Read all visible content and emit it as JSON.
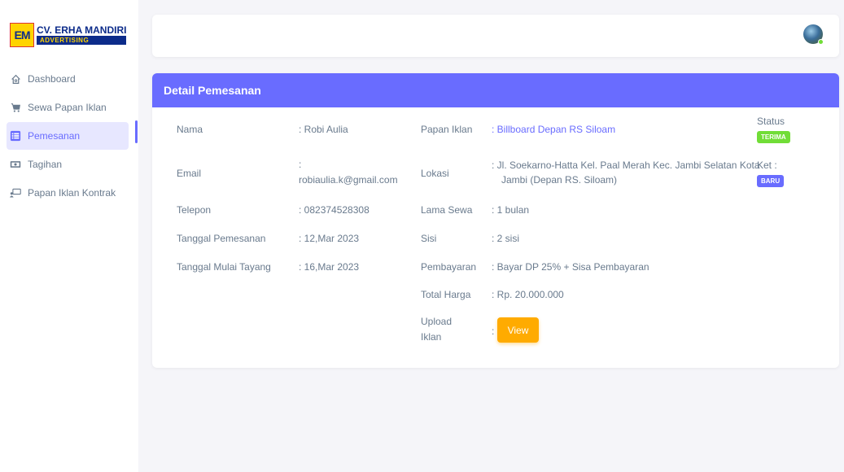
{
  "brand": {
    "mark": "EM",
    "name": "CV. ERHA MANDIRI",
    "sub": "ADVERTISING"
  },
  "sidebar": {
    "items": [
      {
        "label": "Dashboard",
        "icon": "home-icon"
      },
      {
        "label": "Sewa Papan Iklan",
        "icon": "cart-icon"
      },
      {
        "label": "Pemesanan",
        "icon": "list-icon",
        "active": true
      },
      {
        "label": "Tagihan",
        "icon": "money-icon"
      },
      {
        "label": "Papan Iklan Kontrak",
        "icon": "billboard-icon"
      }
    ]
  },
  "card": {
    "title": "Detail Pemesanan",
    "left": [
      {
        "label": "Nama",
        "value": ": Robi Aulia"
      },
      {
        "label": "Email",
        "value_prefix": ":",
        "value": "robiaulia.k@gmail.com"
      },
      {
        "label": "Telepon",
        "value": ": 082374528308"
      },
      {
        "label": "Tanggal Pemesanan",
        "value": ": 12,Mar 2023"
      },
      {
        "label": "Tanggal Mulai Tayang",
        "value": ": 16,Mar 2023"
      }
    ],
    "middle": [
      {
        "label": "Papan Iklan",
        "value": ": Billboard Depan RS Siloam"
      },
      {
        "label": "Lokasi",
        "value_line1": ": Jl. Soekarno-Hatta Kel. Paal Merah Kec. Jambi Selatan Kota",
        "value_line2": "Jambi (Depan RS. Siloam)"
      },
      {
        "label": "Lama Sewa",
        "value": ": 1 bulan"
      },
      {
        "label": "Sisi",
        "value": ": 2 sisi"
      },
      {
        "label": "Pembayaran",
        "value": ": Bayar DP 25% + Sisa Pembayaran"
      },
      {
        "label": "Total Harga",
        "value": ": Rp. 20.000.000"
      },
      {
        "label_line1": "Upload",
        "label_line2": "Iklan",
        "value_prefix": ":",
        "button": "View"
      }
    ],
    "status": {
      "label": "Status",
      "badge": "TERIMA",
      "badge_color": "#71dd37"
    },
    "ket": {
      "label": "Ket :",
      "badge": "BARU",
      "badge_color": "#696cff"
    }
  },
  "colors": {
    "primary": "#696cff",
    "warning": "#ffab00",
    "success": "#71dd37"
  }
}
